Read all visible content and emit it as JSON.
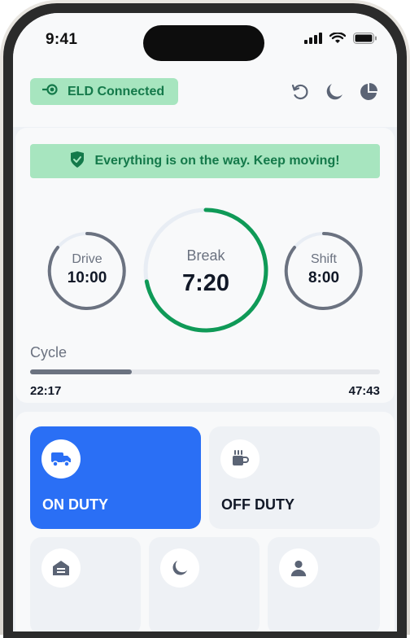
{
  "status_bar": {
    "time": "9:41"
  },
  "header": {
    "eld_status": "ELD Connected"
  },
  "banner": {
    "text": "Everything is on the way. Keep moving!"
  },
  "timers": {
    "drive": {
      "label": "Drive",
      "value": "10:00"
    },
    "break": {
      "label": "Break",
      "value": "7:20",
      "progress": 0.72
    },
    "shift": {
      "label": "Shift",
      "value": "8:00"
    }
  },
  "cycle": {
    "label": "Cycle",
    "used": "22:17",
    "remaining": "47:43",
    "progress": 0.29
  },
  "duty": {
    "on_duty_label": "ON DUTY",
    "off_duty_label": "OFF DUTY"
  },
  "colors": {
    "accent_green": "#14794a",
    "green_bg": "#a7e5bf",
    "primary_blue": "#2a6ff5",
    "ring_green": "#0f9a57"
  },
  "icons": [
    "eld-connected-icon",
    "refresh-icon",
    "moon-icon",
    "pie-chart-icon",
    "shield-check-icon",
    "truck-icon",
    "coffee-icon",
    "sleeper-icon",
    "moon-icon",
    "person-icon"
  ]
}
